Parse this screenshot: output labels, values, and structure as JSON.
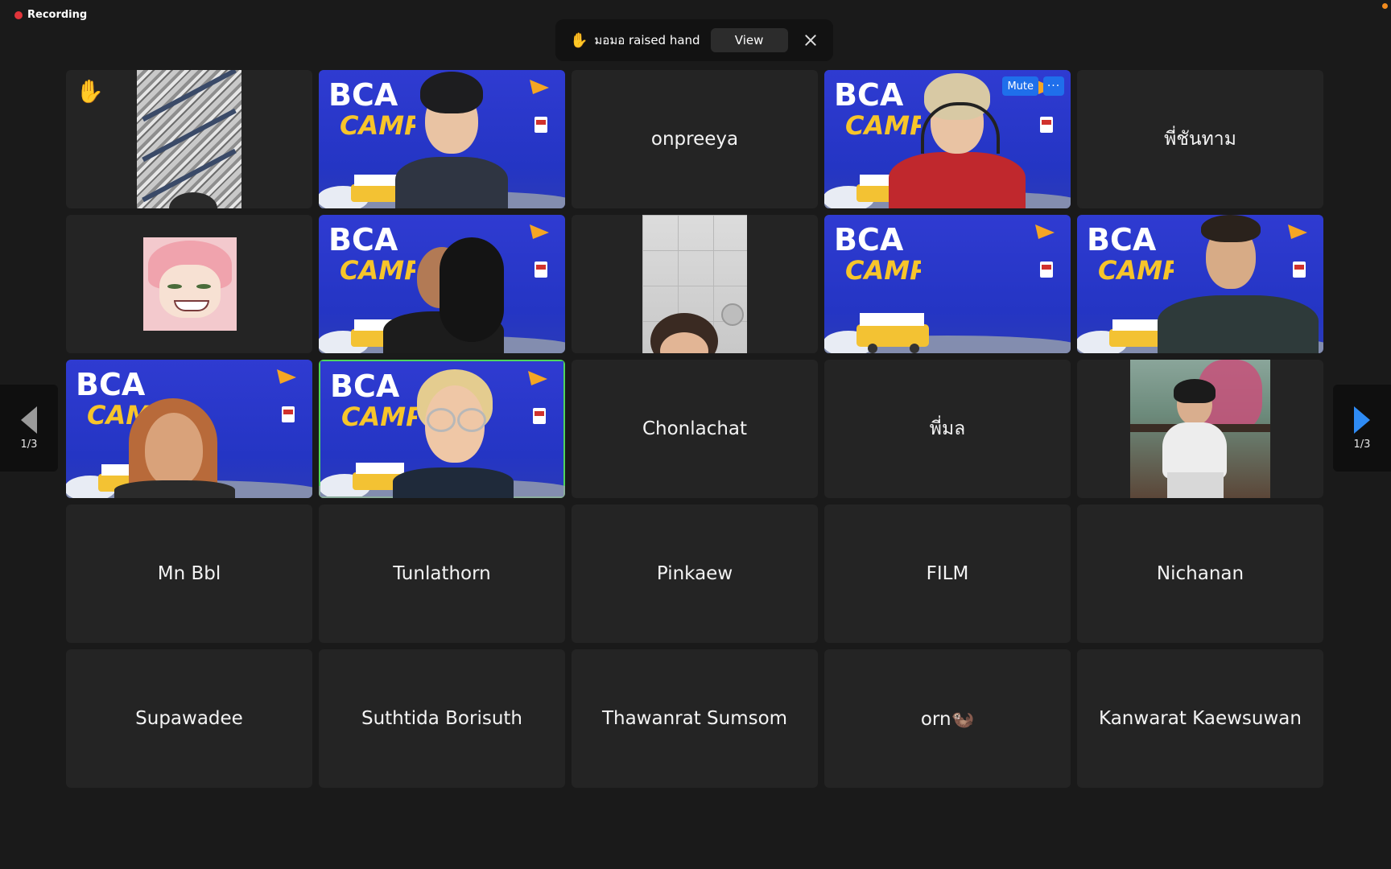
{
  "status": {
    "recording_label": "Recording",
    "recording_color": "#e0343a"
  },
  "notification": {
    "icon": "raised-hand-icon",
    "hand_glyph": "✋",
    "message": "มอมอ raised hand",
    "view_label": "View"
  },
  "tile_controls": {
    "mute_label": "Mute",
    "more_glyph": "···"
  },
  "bca_logo": {
    "line1": "BCA",
    "line2": "CAMP"
  },
  "grid": {
    "participants": [
      {
        "id": "p1",
        "type": "video",
        "raised_hand": true,
        "hand_glyph": "✋"
      },
      {
        "id": "p2",
        "type": "video"
      },
      {
        "id": "p3",
        "type": "name",
        "name": "onpreeya"
      },
      {
        "id": "p4",
        "type": "video",
        "hover": true
      },
      {
        "id": "p5",
        "type": "name",
        "name": "พี่ชันทาม"
      },
      {
        "id": "p6",
        "type": "video"
      },
      {
        "id": "p7",
        "type": "video"
      },
      {
        "id": "p8",
        "type": "video"
      },
      {
        "id": "p9",
        "type": "video"
      },
      {
        "id": "p10",
        "type": "video"
      },
      {
        "id": "p11",
        "type": "video"
      },
      {
        "id": "p12",
        "type": "video",
        "active_speaker": true
      },
      {
        "id": "p13",
        "type": "name",
        "name": "Chonlachat"
      },
      {
        "id": "p14",
        "type": "name",
        "name": "พี่มล"
      },
      {
        "id": "p15",
        "type": "video"
      },
      {
        "id": "p16",
        "type": "name",
        "name": "Mn Bbl"
      },
      {
        "id": "p17",
        "type": "name",
        "name": "Tunlathorn"
      },
      {
        "id": "p18",
        "type": "name",
        "name": "Pinkaew"
      },
      {
        "id": "p19",
        "type": "name",
        "name": "FILM"
      },
      {
        "id": "p20",
        "type": "name",
        "name": "Nichanan"
      },
      {
        "id": "p21",
        "type": "name",
        "name": "Supawadee"
      },
      {
        "id": "p22",
        "type": "name",
        "name": "Suthtida Borisuth"
      },
      {
        "id": "p23",
        "type": "name",
        "name": "Thawanrat Sumsom"
      },
      {
        "id": "p24",
        "type": "name",
        "name": "orn🦦"
      },
      {
        "id": "p25",
        "type": "name",
        "name": "Kanwarat Kaewsuwan"
      }
    ]
  },
  "pagination": {
    "left_label": "1/3",
    "right_label": "1/3",
    "active_arrow_color": "#2e8bf5"
  }
}
